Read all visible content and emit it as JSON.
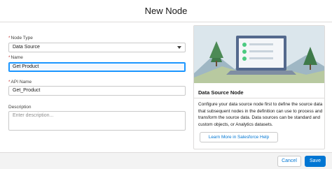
{
  "modal": {
    "title": "New Node"
  },
  "form": {
    "node_type": {
      "required_mark": "*",
      "label": "Node Type",
      "value": "Data Source"
    },
    "name": {
      "required_mark": "*",
      "label": "Name",
      "value": "Get Product"
    },
    "api_name": {
      "required_mark": "*",
      "label": "API Name",
      "value": "Get_Product"
    },
    "description": {
      "label": "Description",
      "placeholder": "Enter description..."
    }
  },
  "info_panel": {
    "illustration": "laptop-with-checklist-illustration",
    "title": "Data Source Node",
    "text": "Configure your data source node first to define the source data that subsequent nodes in the definition can use to process and transform the source data. Data sources can be standard and custom objects, or Analytics datasets.",
    "help_button_label": "Learn More in Salesforce Help"
  },
  "footer": {
    "cancel_label": "Cancel",
    "save_label": "Save"
  },
  "colors": {
    "brand": "#0176d3",
    "required": "#c23934",
    "focus": "#1b96ff"
  }
}
